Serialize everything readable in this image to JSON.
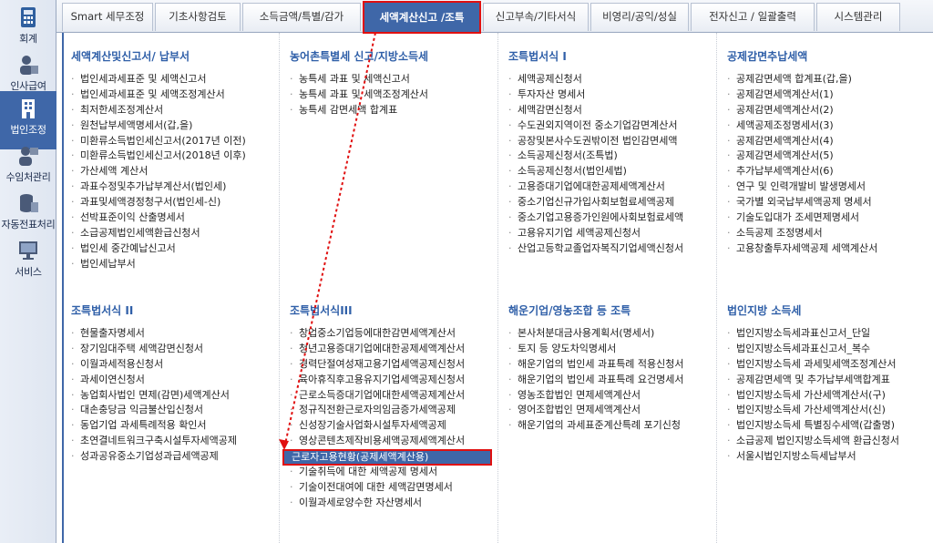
{
  "sidebar": {
    "items": [
      {
        "label": "회계",
        "icon": "calculator-icon"
      },
      {
        "label": "인사급여",
        "icon": "users-icon"
      },
      {
        "label": "법인조정",
        "icon": "building-icon"
      },
      {
        "label": "수임처관리",
        "icon": "client-icon"
      },
      {
        "label": "자동전표처리",
        "icon": "database-icon"
      },
      {
        "label": "서비스",
        "icon": "monitor-icon"
      }
    ]
  },
  "tabs": [
    {
      "label": "Smart 세무조정"
    },
    {
      "label": "기초사항검토"
    },
    {
      "label": "소득금액/특별/감가"
    },
    {
      "label": "세액계산신고 /조특"
    },
    {
      "label": "신고부속/기타서식"
    },
    {
      "label": "비영리/공익/성실"
    },
    {
      "label": "전자신고 / 일괄출력"
    },
    {
      "label": "시스템관리"
    }
  ],
  "sections": [
    {
      "title": "세액계산및신고서/ 납부서",
      "items": [
        "법인세과세표준 및 세액신고서",
        "법인세과세표준 및 세액조정계산서",
        "최저한세조정계산서",
        "원천납부세액명세서(갑,을)",
        "미환류소득법인세신고서(2017년 이전)",
        "미환류소득법인세신고서(2018년 이후)",
        "가산세액 계산서",
        "과표수정및추가납부계산서(법인세)",
        "과표및세액경정청구서(법인세-신)",
        "선박표준이익 산출명세서",
        "소급공제법인세액환급신청서",
        "법인세 중간예납신고서",
        "법인세납부서"
      ]
    },
    {
      "title": "농어촌특별세 신고/지방소득세",
      "items": [
        "농특세 과표 및 세액신고서",
        "농특세 과표 및 세액조정계산서",
        "농특세 감면세액 합계표"
      ]
    },
    {
      "title": "조특법서식 I",
      "items": [
        "세액공제신청서",
        "투자자산 명세서",
        "세액감면신청서",
        "수도권외지역이전 중소기업감면계산서",
        "공장및본사수도권밖이전 법인감면세액",
        "소득공제신청서(조특법)",
        "소득공제신청서(법인세법)",
        "고용증대기업에대한공제세액계산서",
        "중소기업신규가입사회보험료세액공제",
        "중소기업고용증가인원에사회보험료세액",
        "고용유지기업 세액공제신청서",
        "산업고등학교졸업자복직기업세액신청서"
      ]
    },
    {
      "title": "공제감면추납세액",
      "items": [
        "공제감면세액 합계표(갑,을)",
        "공제감면세액계산서(1)",
        "공제감면세액계산서(2)",
        "세액공제조정명세서(3)",
        "공제감면세액계산서(4)",
        "공제감면세액계산서(5)",
        "추가납부세액계산서(6)",
        "연구 및 인력개발비 발생명세서",
        "국가별 외국납부세액공제 명세서",
        "기술도입대가 조세면제명세서",
        "소득공제 조정명세서",
        "고용창출투자세액공제 세액계산서"
      ]
    },
    {
      "title": "조특법서식 II",
      "items": [
        "현물출자명세서",
        "장기임대주택 세액감면신청서",
        "이월과세적용신청서",
        "과세이연신청서",
        "농업회사법인 면제(감면)세액계산서",
        "대손충당금 익금불산입신청서",
        "동업기업 과세특례적용 확인서",
        "초연결네트워크구축시설투자세액공제",
        "성과공유중소기업성과급세액공제"
      ]
    },
    {
      "title": "조특법서식III",
      "items": [
        "창업중소기업등에대한감면세액계산서",
        "청년고용증대기업에대한공제세액계산서",
        "경력단절여성재고용기업세액공제신청서",
        "육아휴직후고용유지기업세액공제신청서",
        "근로소득증대기업에대한세액공제계산서",
        "정규직전환근로자의임금증가세액공제",
        "신성장기술사업화시설투자세액공제",
        "영상콘텐츠제작비용세액공제세액계산서",
        "근로자고용현황(공제세액계산용)",
        "기술취득에 대한 세액공제 명세서",
        "기술이전대여에 대한 세액감면명세서",
        "이월과세로양수한 자산명세서"
      ]
    },
    {
      "title": "해운기업/영농조합 등 조특",
      "items": [
        "본사처분대금사용계획서(명세서)",
        "토지 등 양도차익명세서",
        "해운기업의 법인세 과표특례 적용신청서",
        "해운기업의 법인세 과표특례 요건명세서",
        "영농조합법인 면제세액계산서",
        "영어조합법인 면제세액계산서",
        "해운기업의 과세표준계산특례 포기신청"
      ]
    },
    {
      "title": "법인지방 소득세",
      "items": [
        "법인지방소득세과표신고서_단일",
        "법인지방소득세과표신고서_복수",
        "법인지방소득세 과세및세액조정계산서",
        "공제감면세액 및 추가납부세액합계표",
        "법인지방소득세 가산세액계산서(구)",
        "법인지방소득세 가산세액계산서(신)",
        "법인지방소득세 특별징수세액(갑출명)",
        "소급공제 법인지방소득세액 환급신청서",
        "서울시법인지방소득세납부서"
      ]
    }
  ]
}
